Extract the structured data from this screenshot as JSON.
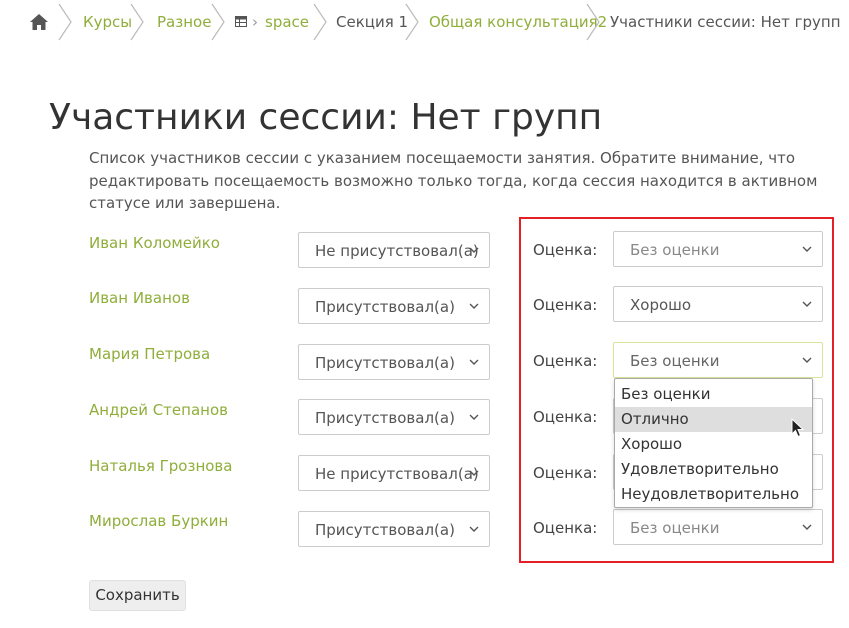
{
  "breadcrumb": {
    "items": [
      {
        "label": "Курсы"
      },
      {
        "label": "Разное"
      },
      {
        "label": "space"
      },
      {
        "label": "Секция 1"
      },
      {
        "label": "Общая консультация2"
      },
      {
        "label": "Участники сессии: Нет групп"
      }
    ],
    "link_color": "#8fae3a"
  },
  "page": {
    "title": "Участники сессии: Нет групп",
    "description": "Список участников сессии с указанием посещаемости занятия. Обратите внимание, что редактировать посещаемость возможно только тогда, когда сессия находится в активном статусе или завершена."
  },
  "grade_label": "Оценка:",
  "participants": [
    {
      "name": "Иван Коломейко",
      "attendance": "Не присутствовал(а)",
      "grade": "Без оценки"
    },
    {
      "name": "Иван Иванов",
      "attendance": "Присутствовал(а)",
      "grade": "Хорошо"
    },
    {
      "name": "Мария Петрова",
      "attendance": "Присутствовал(а)",
      "grade": "Без оценки"
    },
    {
      "name": "Андрей Степанов",
      "attendance": "Присутствовал(а)",
      "grade": ""
    },
    {
      "name": "Наталья Грознова",
      "attendance": "Не присутствовал(а)",
      "grade": ""
    },
    {
      "name": "Мирослав Буркин",
      "attendance": "Присутствовал(а)",
      "grade": "Без оценки"
    }
  ],
  "grade_dropdown": {
    "open_for_participant": "Мария Петрова",
    "options": [
      "Без оценки",
      "Отлично",
      "Хорошо",
      "Удовлетворительно",
      "Неудовлетворительно"
    ],
    "hovered_option": "Отлично"
  },
  "highlight_color": "#e61e25",
  "save_label": "Сохранить",
  "icons": {
    "home": "home-icon",
    "table": "table-icon",
    "chevron": "chevron-down-icon",
    "cursor": "mouse-pointer-icon"
  }
}
